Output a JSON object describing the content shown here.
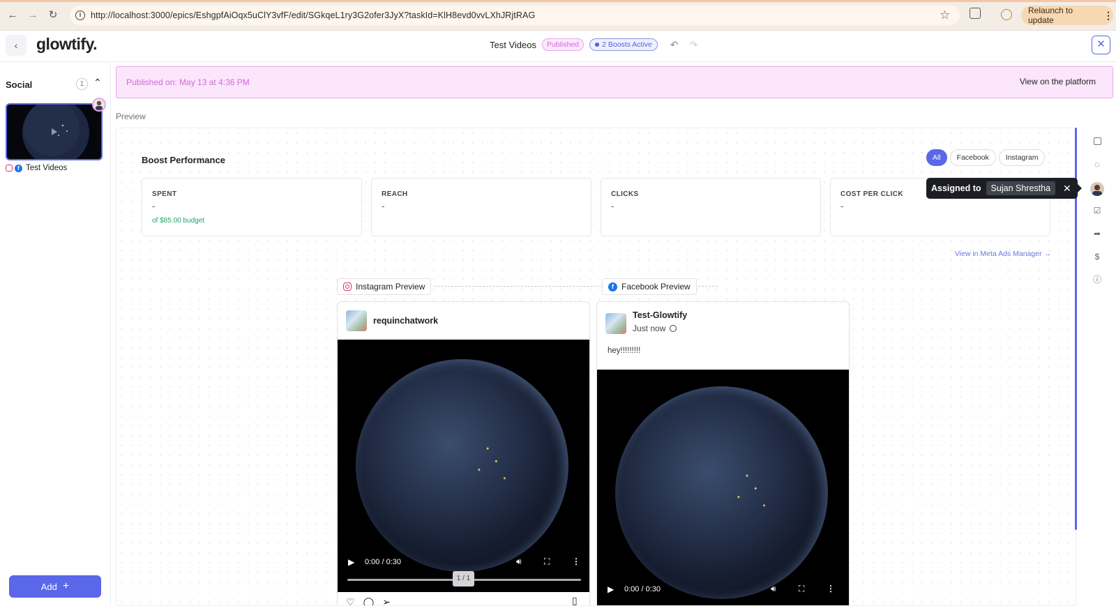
{
  "browser": {
    "url": "http://localhost:3000/epics/EshgpfAiOqx5uClY3vfF/edit/SGkqeL1ry3G2ofer3JyX?taskId=KlH8evd0vvLXhJRjtRAG",
    "relaunch_label": "Relaunch to update",
    "back_icon": "arrow-left-icon",
    "forward_icon": "arrow-right-icon",
    "reload_icon": "reload-icon"
  },
  "header": {
    "logo": "glowtify.",
    "title": "Test Videos",
    "status_badge": "Published",
    "boosts_badge": "2 Boosts Active",
    "undo": "↶",
    "redo": "↷",
    "close": "✕",
    "back": "‹"
  },
  "sidebar": {
    "section_title": "Social",
    "count": "1",
    "chevron": "⌃",
    "items": [
      {
        "label": "Test Videos"
      }
    ],
    "add_label": "Add",
    "add_icon": "+"
  },
  "banner": {
    "published_text": "Published on: May 13 at 4:36 PM",
    "view_link": "View on the platform"
  },
  "preview": {
    "label": "Preview",
    "boost_title": "Boost Performance",
    "filters": [
      "All",
      "Facebook",
      "Instagram"
    ],
    "active_filter": "All",
    "stats": [
      {
        "label": "SPENT",
        "value": "-",
        "sub": "of $85.00 budget"
      },
      {
        "label": "REACH",
        "value": "-"
      },
      {
        "label": "CLICKS",
        "value": "-"
      },
      {
        "label": "COST PER CLICK",
        "value": "-"
      }
    ],
    "meta_link": "View in Meta Ads Manager →"
  },
  "instagram": {
    "tag": "Instagram Preview",
    "username": "requinchatwork",
    "time": "0:00 / 0:30",
    "counter": "1 / 1"
  },
  "facebook": {
    "tag": "Facebook Preview",
    "page_name": "Test-Glowtify",
    "posted": "Just now",
    "caption": "hey!!!!!!!!!",
    "time": "0:00 / 0:30"
  },
  "tooltip": {
    "label": "Assigned to",
    "name": "Sujan Shrestha",
    "close": "✕"
  },
  "colors": {
    "accent": "#5a67e8",
    "published_pink": "#d26ad8",
    "success_green": "#17a86b",
    "instagram": "#e1306c",
    "facebook": "#1877f2"
  }
}
